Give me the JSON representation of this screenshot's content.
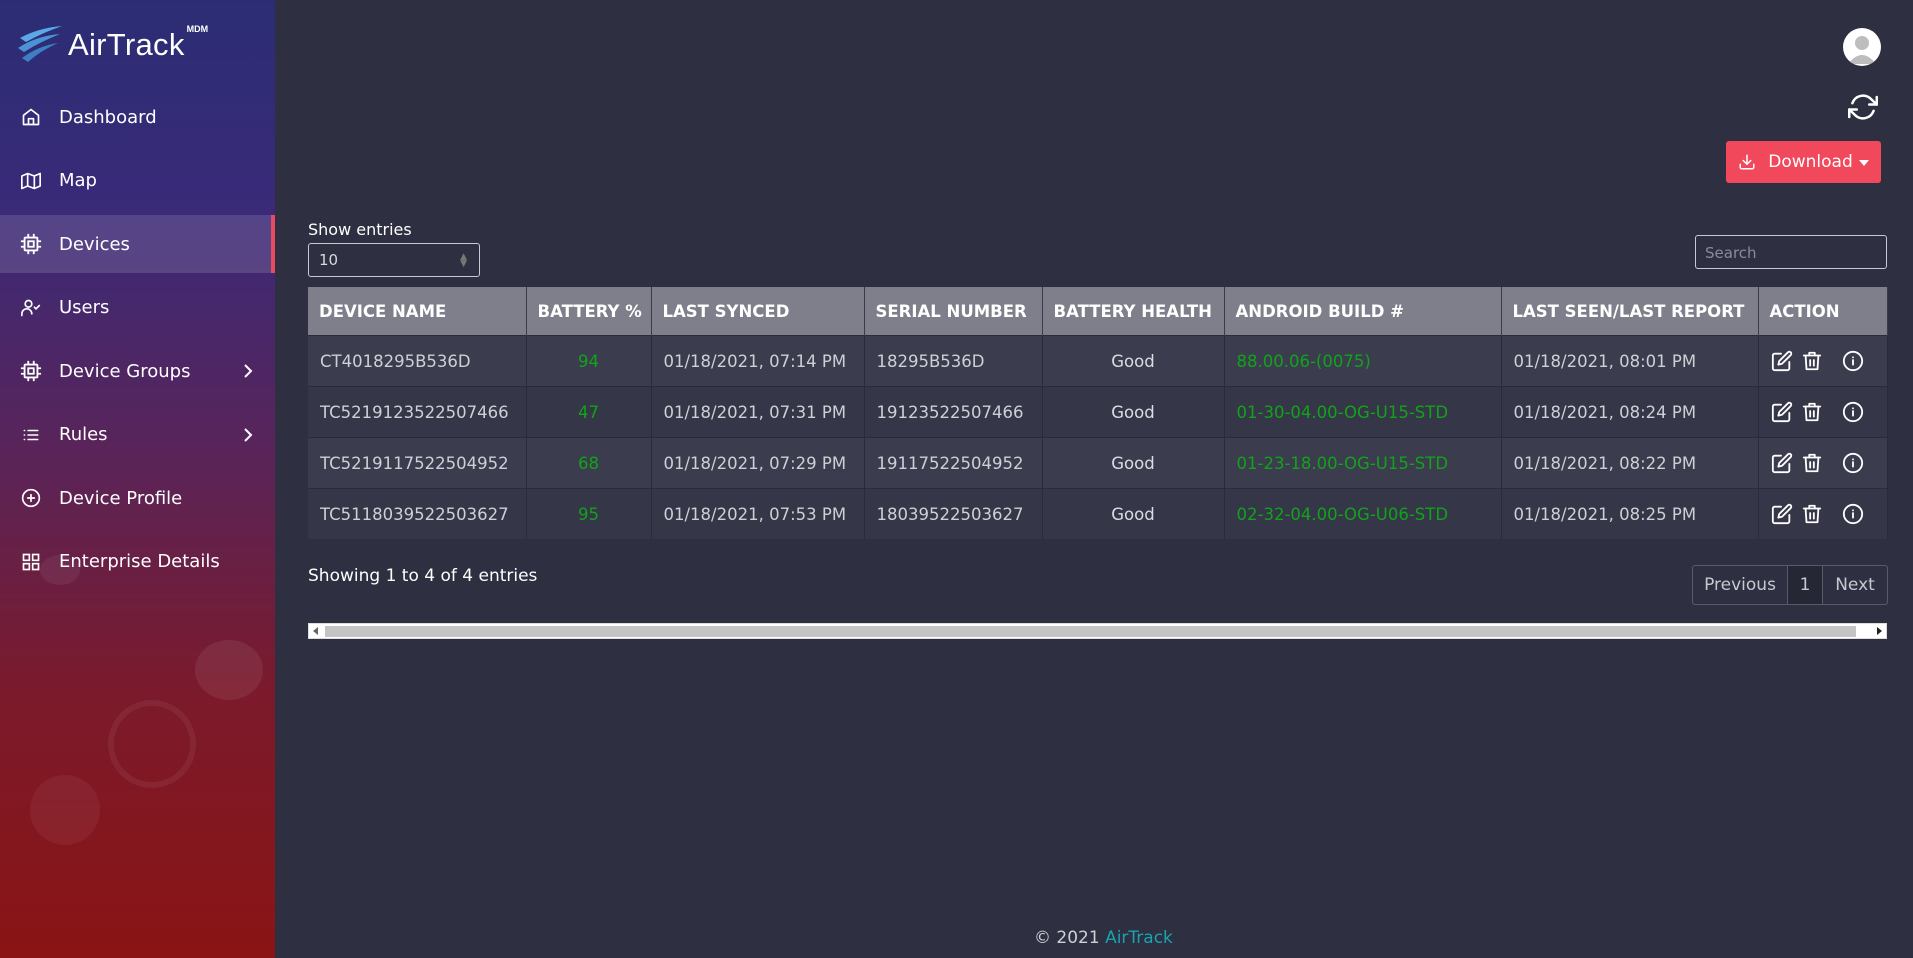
{
  "app": {
    "brand": "AirTrack",
    "brand_superscript": "MDM"
  },
  "sidebar": {
    "items": [
      {
        "label": "Dashboard",
        "icon": "home-icon"
      },
      {
        "label": "Map",
        "icon": "map-icon"
      },
      {
        "label": "Devices",
        "icon": "chip-icon",
        "active": true
      },
      {
        "label": "Users",
        "icon": "user-check-icon"
      },
      {
        "label": "Device Groups",
        "icon": "chip-icon",
        "has_submenu": true
      },
      {
        "label": "Rules",
        "icon": "list-icon",
        "has_submenu": true
      },
      {
        "label": "Device Profile",
        "icon": "plus-circle-icon"
      },
      {
        "label": "Enterprise Details",
        "icon": "grid-icon"
      }
    ]
  },
  "toolbar": {
    "download_label": "Download"
  },
  "table_controls": {
    "show_entries_label": "Show entries",
    "entries_value": "10",
    "search_placeholder": "Search"
  },
  "table": {
    "columns": [
      "DEVICE NAME",
      "BATTERY %",
      "LAST SYNCED",
      "SERIAL NUMBER",
      "BATTERY HEALTH",
      "ANDROID BUILD #",
      "LAST SEEN/LAST REPORT",
      "ACTION"
    ],
    "rows": [
      {
        "device_name": "CT4018295B536D",
        "battery": "94",
        "last_synced": "01/18/2021, 07:14 PM",
        "serial": "18295B536D",
        "health": "Good",
        "build": "88.00.06-(0075)",
        "last_seen": "01/18/2021, 08:01 PM"
      },
      {
        "device_name": "TC5219123522507466",
        "battery": "47",
        "last_synced": "01/18/2021, 07:31 PM",
        "serial": "19123522507466",
        "health": "Good",
        "build": "01-30-04.00-OG-U15-STD",
        "last_seen": "01/18/2021, 08:24 PM"
      },
      {
        "device_name": "TC5219117522504952",
        "battery": "68",
        "last_synced": "01/18/2021, 07:29 PM",
        "serial": "19117522504952",
        "health": "Good",
        "build": "01-23-18.00-OG-U15-STD",
        "last_seen": "01/18/2021, 08:22 PM"
      },
      {
        "device_name": "TC5118039522503627",
        "battery": "95",
        "last_synced": "01/18/2021, 07:53 PM",
        "serial": "18039522503627",
        "health": "Good",
        "build": "02-32-04.00-OG-U06-STD",
        "last_seen": "01/18/2021, 08:25 PM"
      }
    ]
  },
  "pagination": {
    "summary": "Showing 1 to 4 of 4 entries",
    "previous": "Previous",
    "current_page": "1",
    "next": "Next"
  },
  "footer": {
    "copyright": "© 2021",
    "link": "AirTrack"
  },
  "colors": {
    "accent": "#f1495b",
    "value_green": "#11a31a",
    "link": "#19a3b0"
  }
}
